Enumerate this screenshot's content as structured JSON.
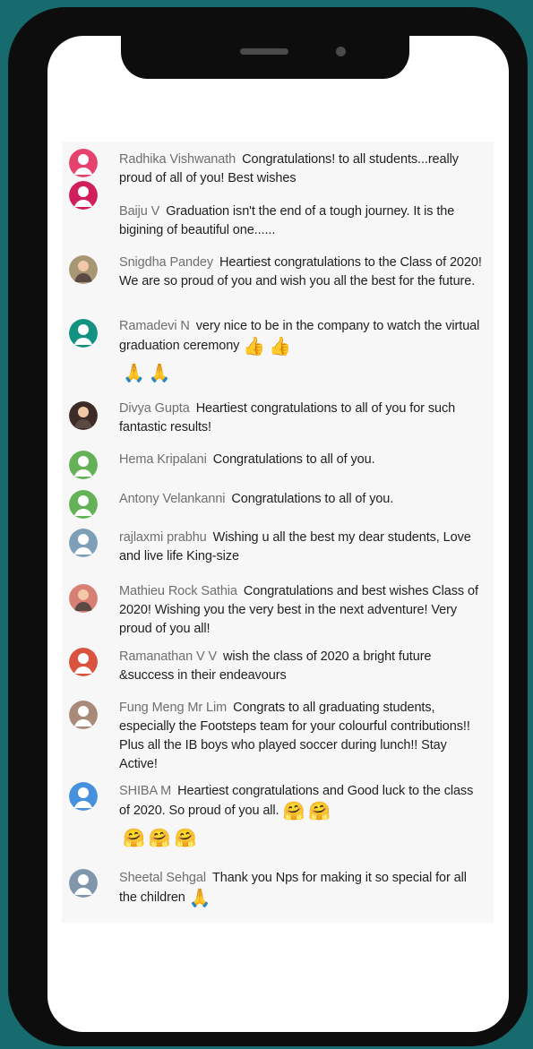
{
  "messages": [
    {
      "author": "Radhika Vishwanath",
      "text": "Congratulations! to all students...really proud of all of you! Best wishes",
      "avatar_color": "#e5436d",
      "avatar_type": "default",
      "emojis": [],
      "emoji_row": []
    },
    {
      "author": "Baiju V",
      "text": "Graduation isn't the end of a tough journey. It is the bigining of beautiful one......",
      "avatar_color": "#d11f5e",
      "avatar_type": "default",
      "emojis": [],
      "emoji_row": []
    },
    {
      "author": "Snigdha Pandey",
      "text": "Heartiest congratulations to the Class of 2020! We are so proud of you and wish you all the best for the future.",
      "avatar_color": "#a89774",
      "avatar_type": "photo",
      "emojis": [],
      "emoji_row": []
    },
    {
      "author": "Ramadevi N",
      "text": "very nice to be in the company to watch the virtual graduation ceremony",
      "avatar_color": "#139282",
      "avatar_type": "default",
      "emojis": [
        "👍",
        "👍"
      ],
      "emoji_row": [
        "🙏",
        "🙏"
      ]
    },
    {
      "author": "Divya Gupta",
      "text": "Heartiest congratulations to all of you for such fantastic results!",
      "avatar_color": "#3d2c27",
      "avatar_type": "photo",
      "emojis": [],
      "emoji_row": []
    },
    {
      "author": "Hema Kripalani",
      "text": "Congratulations to all of you.",
      "avatar_color": "#64b157",
      "avatar_type": "default",
      "emojis": [],
      "emoji_row": []
    },
    {
      "author": "Antony Velankanni",
      "text": "Congratulations to all of you.",
      "avatar_color": "#64b157",
      "avatar_type": "default",
      "emojis": [],
      "emoji_row": []
    },
    {
      "author": "rajlaxmi prabhu",
      "text": "Wishing u all the best my dear students, Love and live life King-size",
      "avatar_color": "#7e9fb8",
      "avatar_type": "default",
      "emojis": [],
      "emoji_row": []
    },
    {
      "author": "Mathieu Rock Sathia",
      "text": "Congratulations and best wishes Class of 2020! Wishing you the very best in the next adventure! Very proud of you all!",
      "avatar_color": "#d77f74",
      "avatar_type": "photo",
      "emojis": [],
      "emoji_row": []
    },
    {
      "author": "Ramanathan V V",
      "text": "wish the class of 2020 a bright future &success in their endeavours",
      "avatar_color": "#d9533f",
      "avatar_type": "default",
      "emojis": [],
      "emoji_row": []
    },
    {
      "author": "Fung Meng Mr Lim",
      "text": "Congrats to all graduating students, especially the Footsteps team for your colourful contributions!! Plus all the IB boys who played soccer during lunch!! Stay Active!",
      "avatar_color": "#a98978",
      "avatar_type": "default",
      "emojis": [],
      "emoji_row": []
    },
    {
      "author": "SHIBA M",
      "text": "Heartiest congratulations and Good luck to the class of 2020. So proud of you all.",
      "avatar_color": "#4691dd",
      "avatar_type": "default",
      "emojis": [
        "🤗",
        "🤗"
      ],
      "emoji_row": [
        "🤗",
        "🤗",
        "🤗"
      ]
    },
    {
      "author": "Sheetal Sehgal",
      "text": "Thank you Nps for making it so special for all the children",
      "avatar_color": "#7f96ad",
      "avatar_type": "default",
      "emojis": [
        "🙏"
      ],
      "emoji_row": []
    }
  ]
}
